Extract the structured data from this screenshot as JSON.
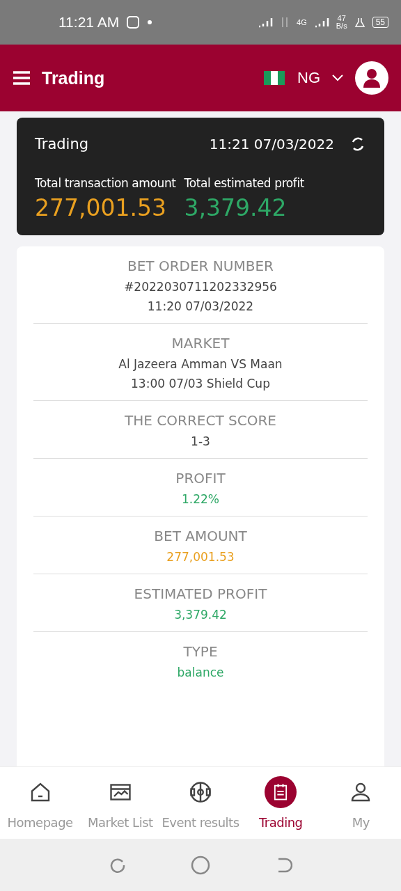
{
  "status_bar": {
    "time": "11:21 AM",
    "network_type": "4G",
    "speed_value": "47",
    "speed_unit": "B/s",
    "battery": "55"
  },
  "header": {
    "title": "Trading",
    "country": "NG"
  },
  "summary": {
    "title": "Trading",
    "datetime": "11:21 07/03/2022",
    "stats": [
      {
        "label": "Total transaction amount",
        "value": "277,001.53",
        "color": "#e9a020"
      },
      {
        "label": "Total estimated profit",
        "value": "3,379.42",
        "color": "#2ea866"
      }
    ]
  },
  "details": [
    {
      "label": "BET ORDER NUMBER",
      "lines": [
        "#2022030711202332956",
        "11:20 07/03/2022"
      ],
      "color": "#444444"
    },
    {
      "label": "MARKET",
      "lines": [
        "Al Jazeera Amman VS Maan",
        "13:00 07/03 Shield Cup"
      ],
      "color": "#444444"
    },
    {
      "label": "THE CORRECT SCORE",
      "lines": [
        "1-3"
      ],
      "color": "#444444"
    },
    {
      "label": "PROFIT",
      "lines": [
        "1.22%"
      ],
      "color": "#2ea866"
    },
    {
      "label": "BET AMOUNT",
      "lines": [
        "277,001.53"
      ],
      "color": "#e9a020"
    },
    {
      "label": "ESTIMATED PROFIT",
      "lines": [
        "3,379.42"
      ],
      "color": "#2ea866"
    },
    {
      "label": "TYPE",
      "lines": [
        "balance"
      ],
      "color": "#2ea866"
    }
  ],
  "bottom_nav": [
    {
      "label": "Homepage",
      "kind": "home",
      "selected": false
    },
    {
      "label": "Market List",
      "kind": "chart",
      "selected": false
    },
    {
      "label": "Event results",
      "kind": "field",
      "selected": false
    },
    {
      "label": "Trading",
      "kind": "clipboard",
      "selected": true
    },
    {
      "label": "My",
      "kind": "user",
      "selected": false
    }
  ]
}
